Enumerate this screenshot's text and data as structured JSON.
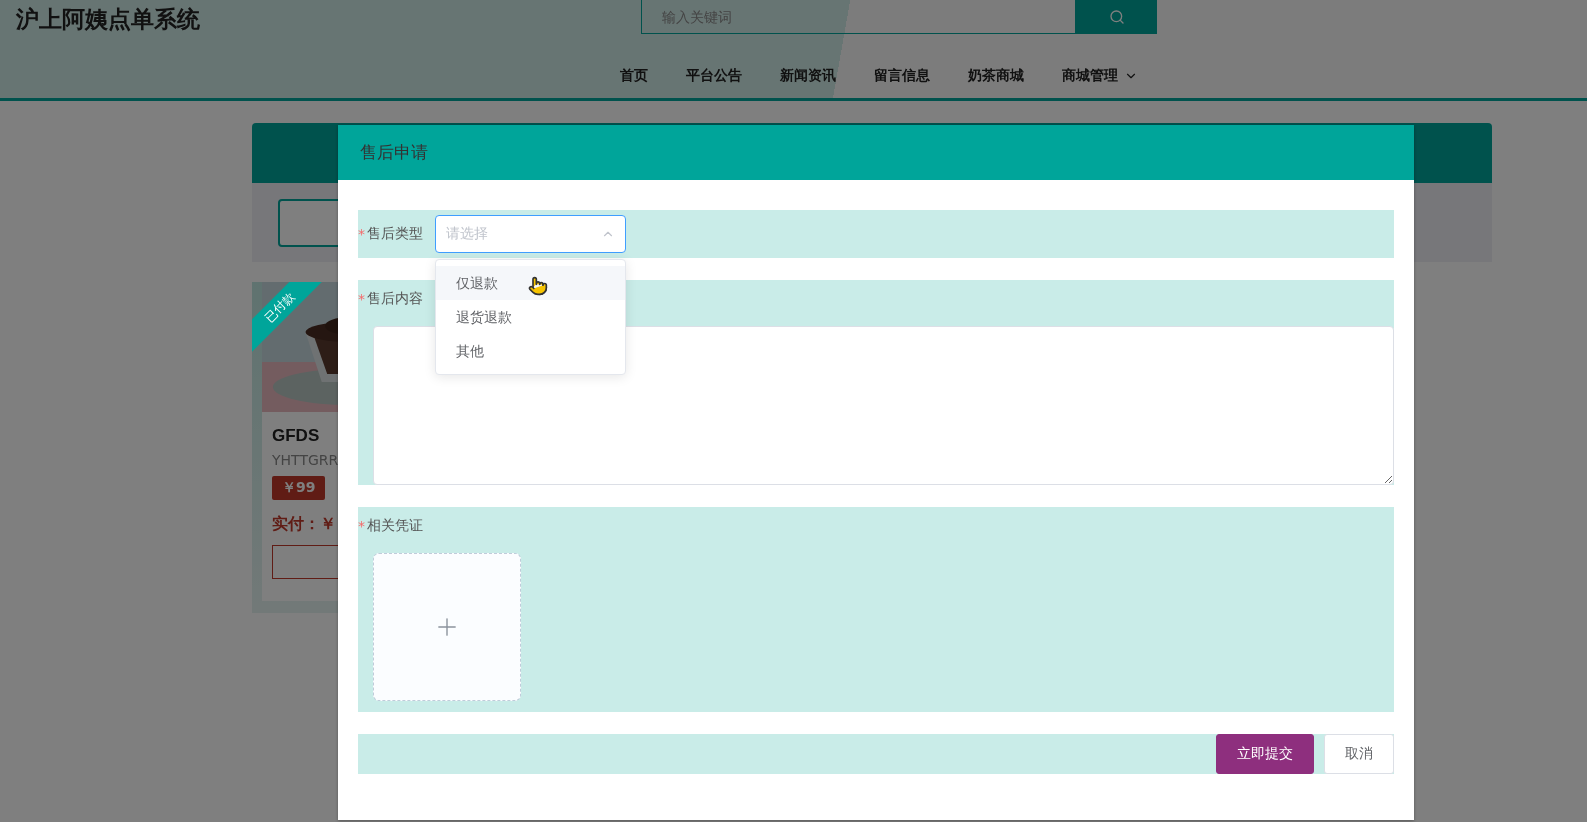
{
  "header": {
    "title": "沪上阿姨点单系统",
    "search": {
      "placeholder": "输入关键词"
    },
    "nav": [
      {
        "label": "首页",
        "kind": "link"
      },
      {
        "label": "平台公告",
        "kind": "link"
      },
      {
        "label": "新闻资讯",
        "kind": "link"
      },
      {
        "label": "留言信息",
        "kind": "link"
      },
      {
        "label": "奶茶商城",
        "kind": "link"
      },
      {
        "label": "商城管理",
        "kind": "menu"
      }
    ]
  },
  "order_card": {
    "badge": "已付款",
    "name": "GFDS",
    "description": "YHTTGRR",
    "price": "￥99",
    "paid": "实付：￥"
  },
  "dialog": {
    "title": "售后申请",
    "fields": [
      {
        "kind": "select",
        "label": "售后类型",
        "required_mark": "*",
        "placeholder": "请选择",
        "expanded": true,
        "options": [
          {
            "label": "仅退款",
            "highlighted": true
          },
          {
            "label": "退货退款",
            "highlighted": false
          },
          {
            "label": "其他",
            "highlighted": false
          }
        ]
      },
      {
        "kind": "textarea",
        "label": "售后内容",
        "required_mark": "*"
      },
      {
        "kind": "upload",
        "label": "相关凭证",
        "required_mark": "*"
      }
    ],
    "buttons": [
      {
        "label": "立即提交",
        "kind": "primary"
      },
      {
        "label": "取消",
        "kind": "default"
      }
    ]
  }
}
